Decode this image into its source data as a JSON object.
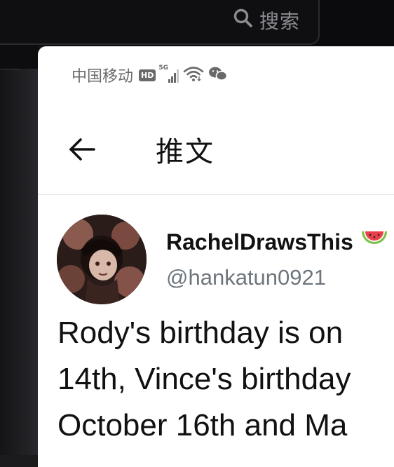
{
  "app": {
    "search_label": "搜索"
  },
  "status_bar": {
    "carrier": "中国移动",
    "hd_badge": "HD",
    "network": "5G"
  },
  "nav": {
    "title": "推文"
  },
  "tweet": {
    "display_name": "RachelDrawsThis",
    "handle": "@hankatun0921",
    "text_lines": [
      "Rody's birthday is on",
      "14th, Vince's birthday",
      "October 16th and Ma"
    ]
  }
}
